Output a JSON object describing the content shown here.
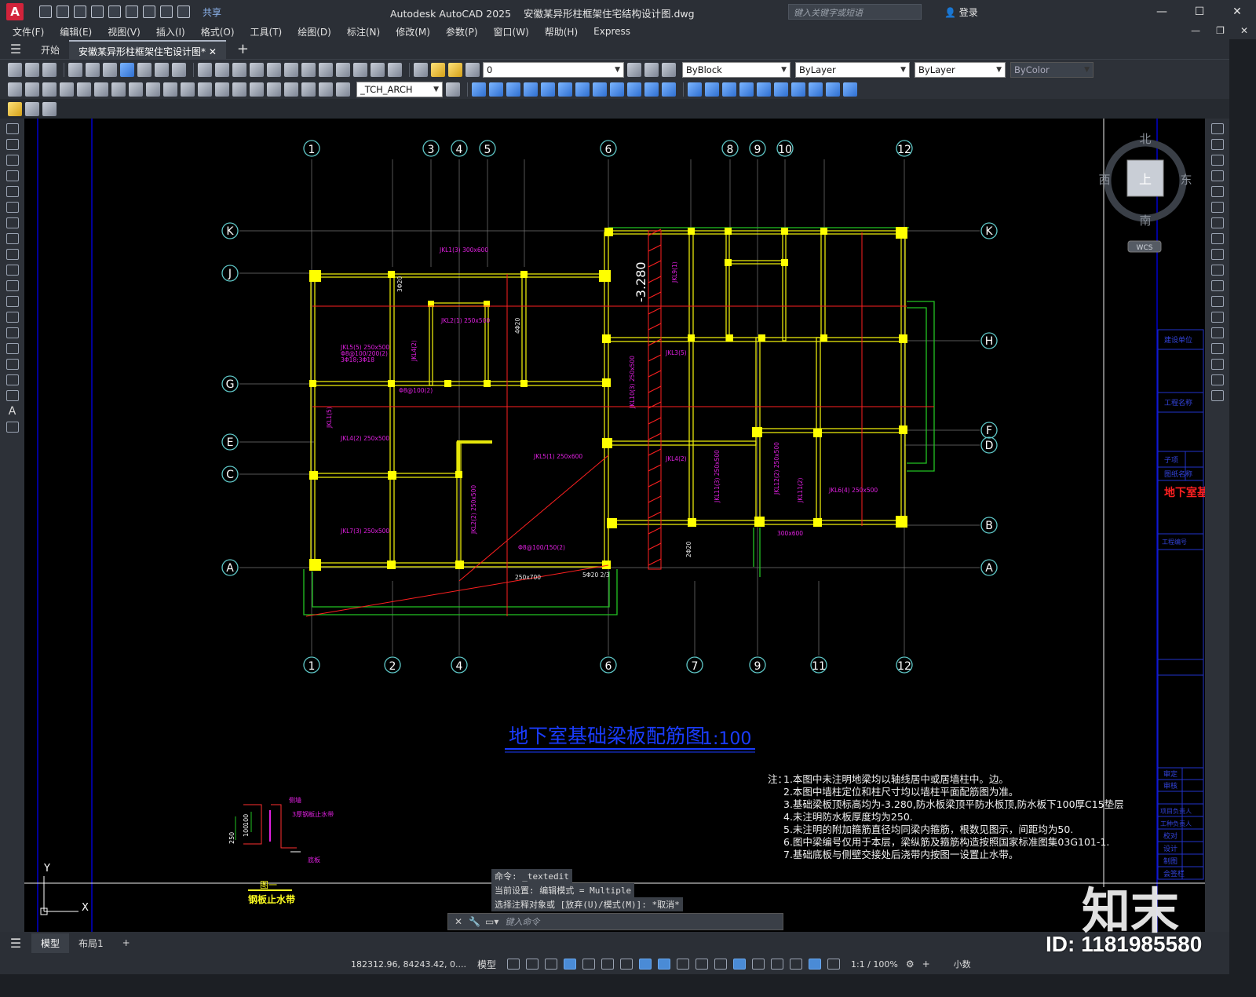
{
  "titlebar": {
    "app_name": "Autodesk AutoCAD 2025",
    "file_name": "安徽某异形柱框架住宅结构设计图.dwg",
    "share_label": "共享",
    "search_placeholder": "键入关键字或短语",
    "login_label": "登录"
  },
  "menu": {
    "items": [
      "文件(F)",
      "编辑(E)",
      "视图(V)",
      "插入(I)",
      "格式(O)",
      "工具(T)",
      "绘图(D)",
      "标注(N)",
      "修改(M)",
      "参数(P)",
      "窗口(W)",
      "帮助(H)",
      "Express"
    ]
  },
  "tabs": {
    "start_label": "开始",
    "active_label": "安徽某异形柱框架住宅设计图*"
  },
  "toolbar": {
    "layer_name": "0",
    "color_value": "ByBlock",
    "linetype_value": "ByLayer",
    "lineweight_value": "ByLayer",
    "plotstyle_value": "ByColor",
    "textstyle_value": "_TCH_ARCH"
  },
  "viewcube": {
    "north": "北",
    "south": "南",
    "east": "东",
    "west": "西",
    "face": "上",
    "wcs": "WCS"
  },
  "drawing": {
    "axes_top": [
      "1",
      "3",
      "4",
      "5",
      "6",
      "8",
      "9",
      "10",
      "12"
    ],
    "axes_bottom": [
      "1",
      "2",
      "4",
      "6",
      "7",
      "9",
      "11",
      "12"
    ],
    "axes_rows": [
      "K",
      "J",
      "G",
      "E",
      "C",
      "A",
      "H",
      "F",
      "D",
      "B",
      "A",
      "K"
    ],
    "elevation_label": "-3.280",
    "main_title": "地下室基础梁板配筋图",
    "main_scale": "1:100",
    "beam_labels": [
      "JKL1(3) 300x600",
      "JKL5(5) 250x500",
      "JKL2(1) 250x500",
      "JKL4(2)",
      "JKL1(5)",
      "JKL4(2) 250x500",
      "JKL7(3) 250x500",
      "JKL5(1) 250x600",
      "JKL2(2) 250x500",
      "JKL10(3) 250x500",
      "JKL9(1)",
      "JKL3(5)",
      "JKL11(3) 250x500",
      "JKL12(2) 250x500",
      "JKL6(4) 250x500",
      "JKL11(2)",
      "JKL4(2)"
    ],
    "rebar_labels": [
      "Φ8@100(2)",
      "Φ8@100/200(2)",
      "3Φ18;3Φ18",
      "3Φ20",
      "4Φ20",
      "2Φ20",
      "250x700",
      "5Φ20 2/3",
      "Φ8@100/150(2)",
      "300x600"
    ],
    "notes_title": "注：",
    "notes": [
      "1.本图中未注明地梁均以轴线居中或居墙柱中。边。",
      "2.本图中墙柱定位和柱尺寸均以墙柱平面配筋图为准。",
      "3.基础梁板顶标高均为-3.280,防水板梁顶平防水板顶,防水板下100厚C15垫层",
      "4.未注明防水板厚度均为250.",
      "5.未注明的附加箍筋直径均同梁内箍筋，根数见图示，间距均为50.",
      "6.图中梁编号仅用于本层，梁纵筋及箍筋构造按照国家标准图集03G101-1.",
      "7.基础底板与侧壁交接处后浇带内按图一设置止水带。"
    ],
    "detail_labels": [
      "侧墙",
      "3厚钢板止水带",
      "底板",
      "250",
      "100",
      "100"
    ],
    "detail_title_1": "图一",
    "detail_title_2": "钢板止水带",
    "title_block": [
      "建设单位",
      "工程名称",
      "子项",
      "图纸名称",
      "地下室基",
      "工程编号",
      "审定",
      "审核",
      "项目负责人",
      "工种负责人",
      "校对",
      "设计",
      "制图",
      "会签栏"
    ],
    "ucs_y": "Y",
    "ucs_x": "X"
  },
  "command": {
    "history": [
      "命令: _textedit",
      "当前设置: 编辑模式 = Multiple",
      "选择注释对象或 [放弃(U)/模式(M)]: *取消*"
    ],
    "placeholder": "键入命令"
  },
  "layout_tabs": [
    "模型",
    "布局1"
  ],
  "status": {
    "coords": "182312.96, 84243.42, 0....",
    "model_label": "模型",
    "scale": "1:1 / 100%",
    "units": "小数"
  },
  "watermark": {
    "logo": "知末",
    "id": "ID: 1181985580"
  }
}
